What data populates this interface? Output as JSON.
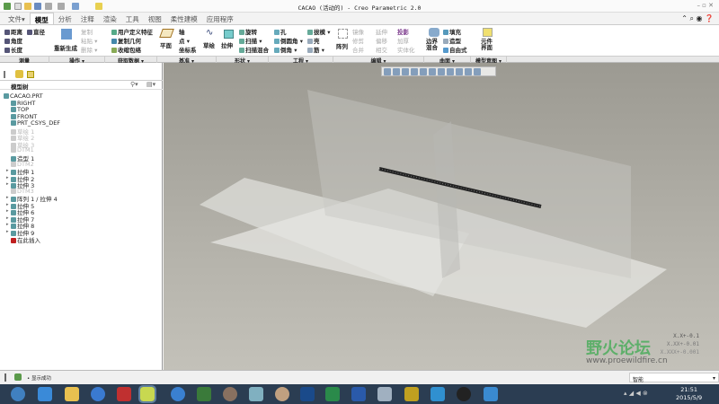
{
  "window": {
    "title": "CACAO (活动的) - Creo Parametric 2.0"
  },
  "tabs": [
    "文件▾",
    "模型",
    "分析",
    "注释",
    "渲染",
    "工具",
    "视图",
    "柔性建模",
    "应用程序"
  ],
  "ribbon": {
    "measure": [
      "距离",
      "直径",
      "角度",
      "长度"
    ],
    "operations": {
      "regen": "重新生成",
      "copy": "复制",
      "paste": "粘贴 ▾",
      "delete": "删除 ▾"
    },
    "getdata": [
      "用户定义特征",
      "复制几何",
      "收缩包络"
    ],
    "datum": {
      "plane": "平面",
      "axis": "轴",
      "point": "点 ▾",
      "csys": "坐标系",
      "sketch": "草绘"
    },
    "shape": {
      "extrude": "拉伸",
      "revolve": "旋转",
      "sweep": "扫描 ▾",
      "sweptblend": "扫描混合"
    },
    "engineering": [
      "孔",
      "倒圆角 ▾",
      "倒角 ▾",
      "拔模 ▾",
      "壳",
      "筋 ▾"
    ],
    "editing": {
      "pattern": "阵列",
      "items": [
        "镜像",
        "延伸",
        "投影",
        "修剪",
        "偏移",
        "加厚",
        "合并",
        "相交",
        "实体化"
      ]
    },
    "surfaces": {
      "boundary": "边界混合",
      "items": [
        "填充",
        "造型",
        "自由式"
      ]
    },
    "intent": {
      "component": "元件界面"
    }
  },
  "groups": [
    "测量",
    "操作 ▾",
    "获取数据 ▾",
    "基准 ▾",
    "形状 ▾",
    "工程 ▾",
    "编辑 ▾",
    "曲面 ▾",
    "模型意图 ▾"
  ],
  "tree": {
    "header": "模型树",
    "items": [
      {
        "label": "CACAO.PRT",
        "dim": false,
        "exp": false
      },
      {
        "label": "RIGHT",
        "dim": false,
        "exp": false
      },
      {
        "label": "TOP",
        "dim": false,
        "exp": false
      },
      {
        "label": "FRONT",
        "dim": false,
        "exp": false
      },
      {
        "label": "PRT_CSYS_DEF",
        "dim": false,
        "exp": false
      },
      {
        "label": "草绘 1",
        "dim": true,
        "exp": false
      },
      {
        "label": "草绘 2",
        "dim": true,
        "exp": false
      },
      {
        "label": "草绘 3",
        "dim": true,
        "exp": false
      },
      {
        "label": "DTM1",
        "dim": true,
        "exp": false
      },
      {
        "label": "造型 1",
        "dim": false,
        "exp": false
      },
      {
        "label": "DTM2",
        "dim": true,
        "exp": false
      },
      {
        "label": "拉伸 1",
        "dim": false,
        "exp": true
      },
      {
        "label": "拉伸 2",
        "dim": false,
        "exp": true
      },
      {
        "label": "拉伸 3",
        "dim": false,
        "exp": true
      },
      {
        "label": "DTM3",
        "dim": true,
        "exp": false
      },
      {
        "label": "阵列 1 / 拉伸 4",
        "dim": false,
        "exp": true
      },
      {
        "label": "拉伸 5",
        "dim": false,
        "exp": true
      },
      {
        "label": "拉伸 6",
        "dim": false,
        "exp": true
      },
      {
        "label": "拉伸 7",
        "dim": false,
        "exp": true
      },
      {
        "label": "拉伸 8",
        "dim": false,
        "exp": true
      },
      {
        "label": "拉伸 9",
        "dim": false,
        "exp": true
      },
      {
        "label": "在此插入",
        "dim": false,
        "exp": false
      }
    ]
  },
  "viewport": {
    "tolerances": [
      "X.X+-0.1",
      "X.XX+-0.01",
      "X.XXX+-0.001"
    ]
  },
  "status": {
    "message": "• 显示成功",
    "filter": "智能"
  },
  "taskbar": {
    "time": "21:51",
    "date": "2015/5/9"
  },
  "watermark": {
    "text": "野火论坛",
    "url": "www.proewildfire.cn"
  }
}
